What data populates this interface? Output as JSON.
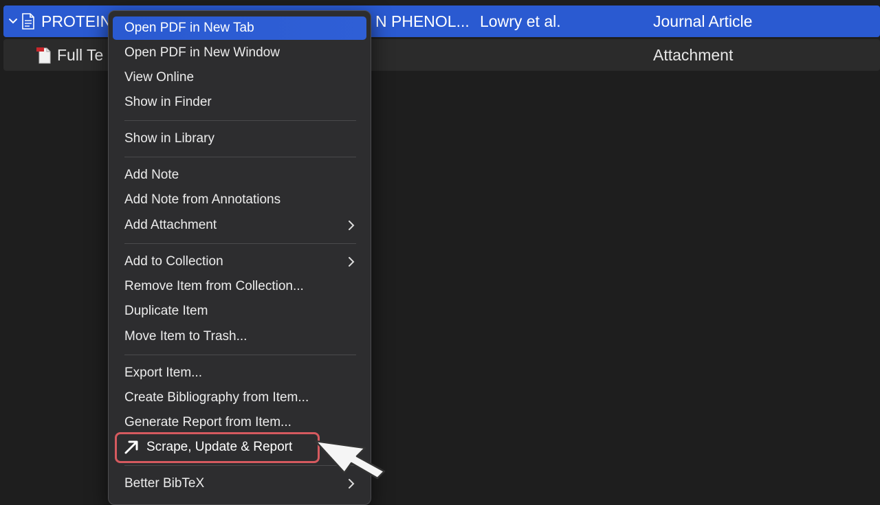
{
  "items": {
    "main_row": {
      "title_visible_left": "PROTEIN",
      "title_visible_right": "N PHENOL...",
      "creator": "Lowry et al.",
      "item_type": "Journal Article"
    },
    "attachment_row": {
      "title_visible": "Full Te",
      "item_type": "Attachment"
    }
  },
  "menu": {
    "items": [
      {
        "label": "Open PDF in New Tab"
      },
      {
        "label": "Open PDF in New Window"
      },
      {
        "label": "View Online"
      },
      {
        "label": "Show in Finder"
      },
      {
        "label": "Show in Library"
      },
      {
        "label": "Add Note"
      },
      {
        "label": "Add Note from Annotations"
      },
      {
        "label": "Add Attachment",
        "submenu": true
      },
      {
        "label": "Add to Collection",
        "submenu": true
      },
      {
        "label": "Remove Item from Collection..."
      },
      {
        "label": "Duplicate Item"
      },
      {
        "label": "Move Item to Trash..."
      },
      {
        "label": "Export Item..."
      },
      {
        "label": "Create Bibliography from Item..."
      },
      {
        "label": "Generate Report from Item..."
      },
      {
        "label": "Scrape, Update & Report",
        "icon": "arrow-up-right-icon",
        "outlined": true
      },
      {
        "label": "Better BibTeX",
        "submenu": true
      }
    ]
  },
  "colors": {
    "selection": "#2a5ad1",
    "callout": "#d65a5f",
    "menu_bg": "#2d2d2f"
  }
}
